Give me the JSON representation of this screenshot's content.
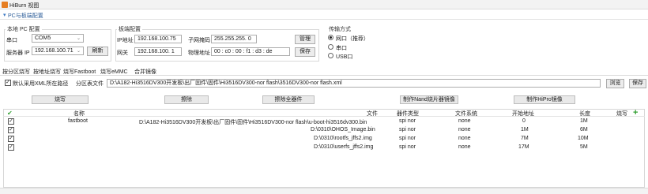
{
  "window": {
    "title": "HiBurn 视图"
  },
  "panel": {
    "title": "PC与板端配置"
  },
  "local_pc": {
    "group_label": "本地 PC 配置",
    "serial_label": "串口",
    "serial_value": "COM5",
    "server_ip_label": "服务器 IP",
    "server_ip_value": "192.168.100.71",
    "refresh_label": "刷新"
  },
  "board": {
    "group_label": "板端配置",
    "ip_label": "IP地址",
    "ip_value": "192.168.100.75",
    "mask_label": "子网掩码",
    "mask_value": "255.255.255. 0",
    "gateway_label": "网关",
    "gateway_value": "192.168.100. 1",
    "mac_label": "物理地址",
    "mac_value": "00 : c0 : 00 : f1 : d3 : de",
    "manage_label": "管理",
    "save_label": "保存"
  },
  "transfer": {
    "group_label": "传输方式",
    "options": [
      "网口（推荐）",
      "串口",
      "USB口"
    ],
    "selected": "网口（推荐）"
  },
  "tabs": [
    "按分区烧写",
    "按地址烧写",
    "烧写Fastboot",
    "烧写eMMC",
    "合并镜像"
  ],
  "active_tab": "按分区烧写",
  "partition_bar": {
    "xml_default_label": "默认采用XML所在路径",
    "xml_default_checked": true,
    "table_file_label": "分区表文件",
    "table_file_value": "D:\\A182-Hi3516DV300开发板\\出厂固件\\固件\\Hi3516DV300-nor flash\\3516DV300-nor flash.xml",
    "browse_label": "浏览",
    "save_label": "保存"
  },
  "actions": {
    "burn": "烧写",
    "erase": "擦除",
    "erase_all": "擦除全器件",
    "nand_image": "制作Nand烧片器镜像",
    "hipro_image": "制作HiPro镜像"
  },
  "table": {
    "columns": [
      "名称",
      "文件",
      "器件类型",
      "文件系统",
      "开始地址",
      "长度",
      "烧写"
    ],
    "rows": [
      {
        "checked": true,
        "name": "fastboot",
        "file": "D:\\A182-Hi3516DV300开发板\\出厂固件\\固件\\Hi3516DV300-nor flash\\u-boot-hi3516dv300.bin",
        "device": "spi nor",
        "fs": "none",
        "start": "0",
        "length": "1M"
      },
      {
        "checked": true,
        "name": "",
        "file": "D:\\0310\\OHOS_Image.bin",
        "device": "spi nor",
        "fs": "none",
        "start": "1M",
        "length": "6M"
      },
      {
        "checked": true,
        "name": "",
        "file": "D:\\0310\\rootfs_jffs2.img",
        "device": "spi nor",
        "fs": "none",
        "start": "7M",
        "length": "10M"
      },
      {
        "checked": true,
        "name": "",
        "file": "D:\\0310\\userfs_jffs2.img",
        "device": "spi nor",
        "fs": "none",
        "start": "17M",
        "length": "5M"
      }
    ]
  },
  "colors": {
    "accent": "#2f5f9a",
    "check_green": "#3aa33a",
    "add_green": "#2e9e2e"
  }
}
